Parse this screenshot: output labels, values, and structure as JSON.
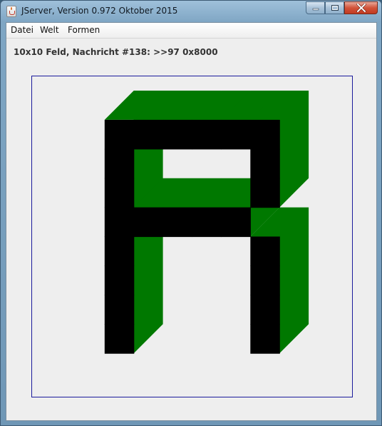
{
  "window": {
    "title": "JServer, Version 0.972 Oktober 2015",
    "controls": [
      "minimize-icon",
      "maximize-icon",
      "close-icon"
    ]
  },
  "menu": {
    "items": [
      "Datei",
      "Welt",
      "Formen"
    ]
  },
  "status": {
    "text": "10x10 Feld, Nachricht #138: >>97 0x8000"
  },
  "board": {
    "cols": 10,
    "rows": 10,
    "border_color": "#1a1a9c",
    "background_color": "#eeeeee",
    "cell_color": "#000000",
    "shadow_color": "#007800",
    "filled_cells": [
      [
        2,
        1
      ],
      [
        3,
        1
      ],
      [
        4,
        1
      ],
      [
        5,
        1
      ],
      [
        6,
        1
      ],
      [
        7,
        1
      ],
      [
        2,
        2
      ],
      [
        7,
        2
      ],
      [
        2,
        3
      ],
      [
        7,
        3
      ],
      [
        2,
        4
      ],
      [
        3,
        4
      ],
      [
        4,
        4
      ],
      [
        5,
        4
      ],
      [
        6,
        4
      ],
      [
        2,
        5
      ],
      [
        7,
        5
      ],
      [
        2,
        6
      ],
      [
        7,
        6
      ],
      [
        2,
        7
      ],
      [
        7,
        7
      ],
      [
        2,
        8
      ],
      [
        7,
        8
      ]
    ]
  }
}
